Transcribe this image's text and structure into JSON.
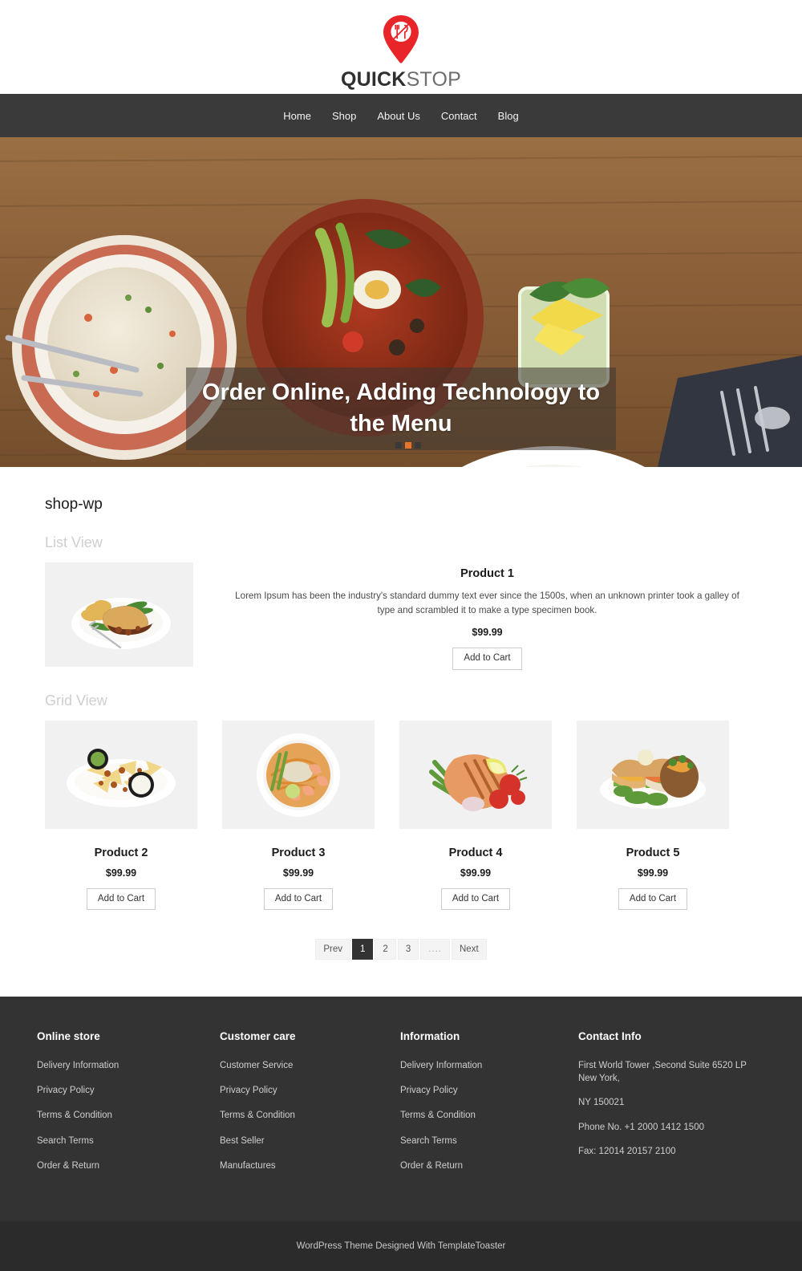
{
  "brand": {
    "name_bold": "QUICK",
    "name_light": "STOP",
    "logo_icon": "location-pin-with-fork-knife-icon",
    "accent_color": "#e8262a"
  },
  "nav": {
    "items": [
      {
        "label": "Home"
      },
      {
        "label": "Shop"
      },
      {
        "label": "About Us"
      },
      {
        "label": "Contact"
      },
      {
        "label": "Blog"
      }
    ]
  },
  "hero": {
    "caption": "Order Online, Adding Technology to the Menu",
    "slider_dots": [
      "inactive",
      "active",
      "inactive"
    ]
  },
  "main": {
    "page_title": "shop-wp",
    "list_view_label": "List View",
    "grid_view_label": "Grid View",
    "add_to_cart_label": "Add to Cart",
    "list_products": [
      {
        "title": "Product 1",
        "description": "Lorem Ipsum has been the industry's standard dummy text ever since the 1500s, when an unknown printer took a galley of type and scrambled it to make a type specimen book.",
        "price": "$99.99",
        "image": "plate-of-pie-chips-and-green-beans"
      }
    ],
    "grid_products": [
      {
        "title": "Product 2",
        "price": "$99.99",
        "image": "loaded-nachos-with-dips"
      },
      {
        "title": "Product 3",
        "price": "$99.99",
        "image": "bowl-of-shrimp-noodles"
      },
      {
        "title": "Product 4",
        "price": "$99.99",
        "image": "grilled-salmon-steak-with-tomatoes"
      },
      {
        "title": "Product 5",
        "price": "$99.99",
        "image": "chicken-sandwich-with-baked-potato"
      }
    ],
    "pagination": [
      {
        "label": "Prev",
        "state": "normal"
      },
      {
        "label": "1",
        "state": "active"
      },
      {
        "label": "2",
        "state": "normal"
      },
      {
        "label": "3",
        "state": "normal"
      },
      {
        "label": "....",
        "state": "dots"
      },
      {
        "label": "Next",
        "state": "normal"
      }
    ]
  },
  "footer": {
    "columns": [
      {
        "title": "Online store",
        "links": [
          "Delivery Information",
          "Privacy Policy",
          "Terms & Condition",
          "Search Terms",
          "Order & Return"
        ]
      },
      {
        "title": "Customer care",
        "links": [
          "Customer Service",
          "Privacy Policy",
          "Terms & Condition",
          "Best Seller",
          "Manufactures"
        ]
      },
      {
        "title": "Information",
        "links": [
          "Delivery Information",
          "Privacy Policy",
          "Terms & Condition",
          "Search Terms",
          "Order & Return"
        ]
      }
    ],
    "contact": {
      "title": "Contact Info",
      "lines": [
        "First World Tower ,Second Suite 6520 LP New York,",
        "NY 150021",
        "Phone No. +1 2000 1412 1500",
        "Fax: 12014 20157 2100"
      ]
    },
    "copyright": "WordPress Theme Designed With TemplateToaster"
  }
}
